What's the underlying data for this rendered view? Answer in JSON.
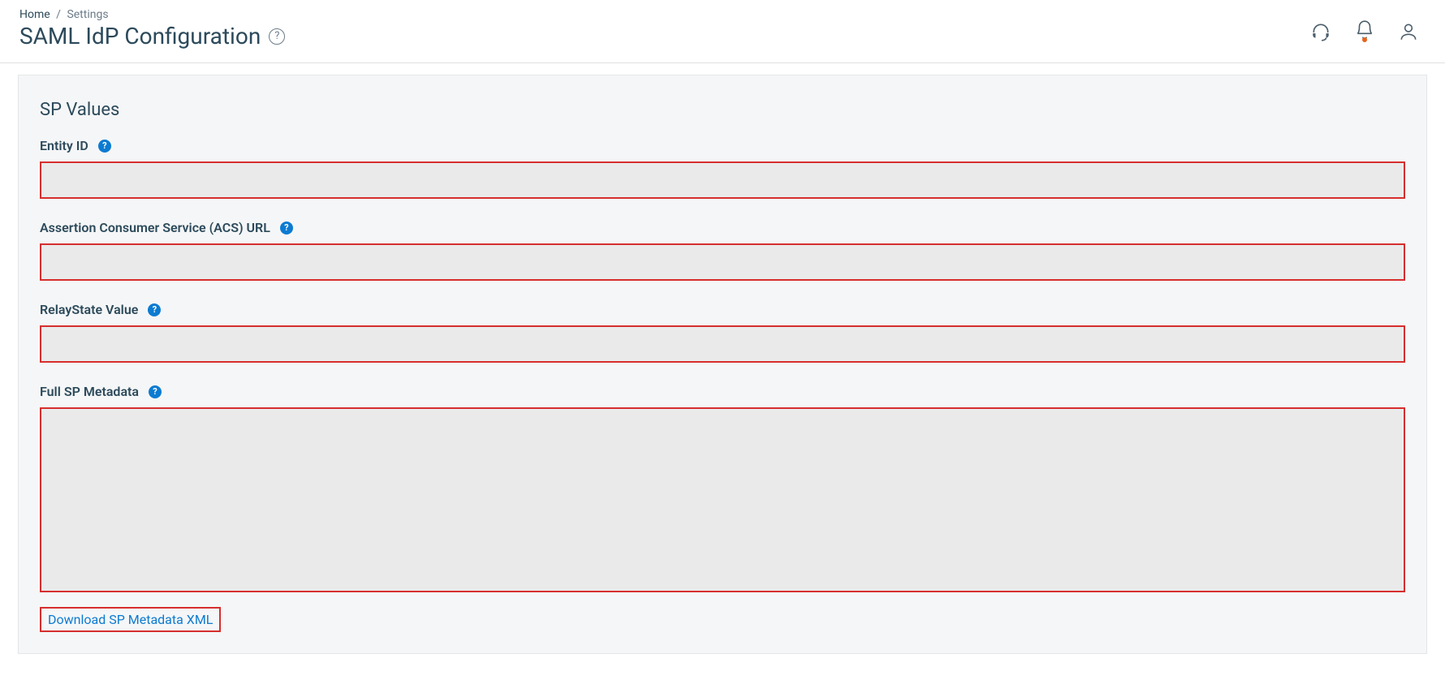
{
  "breadcrumb": {
    "home": "Home",
    "settings": "Settings"
  },
  "page_title": "SAML IdP Configuration",
  "panel": {
    "section_title": "SP Values",
    "entity_id": {
      "label": "Entity ID",
      "value": ""
    },
    "acs_url": {
      "label": "Assertion Consumer Service (ACS) URL",
      "value": ""
    },
    "relay_state": {
      "label": "RelayState Value",
      "value": ""
    },
    "full_sp_metadata": {
      "label": "Full SP Metadata",
      "value": ""
    },
    "download_link": "Download SP Metadata XML"
  }
}
